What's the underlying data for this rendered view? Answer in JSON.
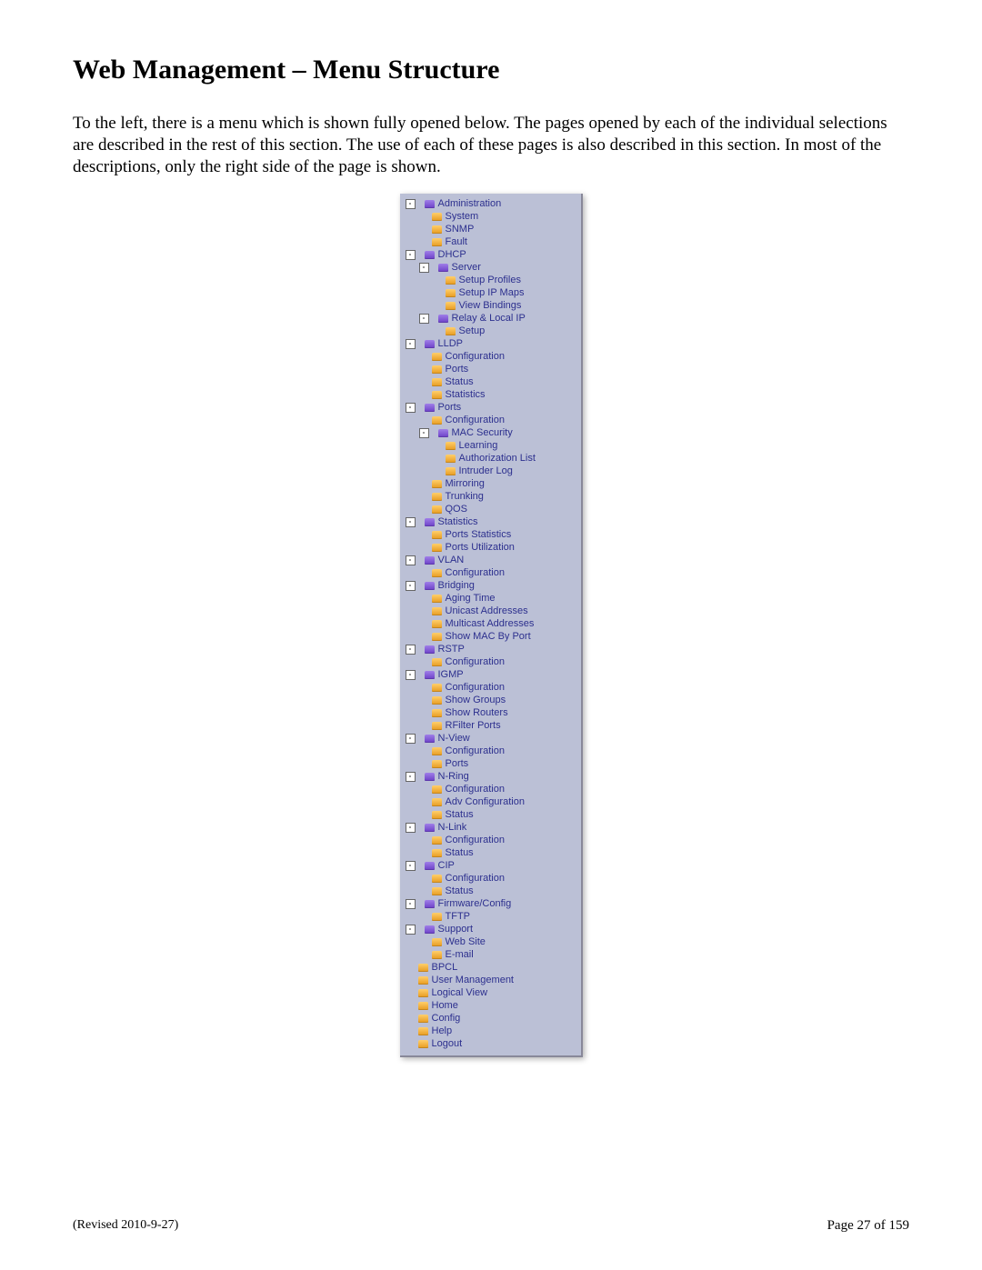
{
  "title": "Web Management – Menu Structure",
  "intro": "To the left, there is a menu which is shown fully opened below.  The pages opened by each of the individual selections are described in the rest of this section.  The use of each of these pages is also described in this section.  In most of the descriptions, only the right side of the page is shown.",
  "footer": {
    "revised": "(Revised 2010-9-27)",
    "page": "Page 27 of 159"
  },
  "menu": [
    {
      "depth": 0,
      "toggle": "-",
      "icon": "purple",
      "label": "Administration"
    },
    {
      "depth": 1,
      "icon": "orange",
      "label": "System"
    },
    {
      "depth": 1,
      "icon": "orange",
      "label": "SNMP"
    },
    {
      "depth": 1,
      "icon": "orange",
      "label": "Fault"
    },
    {
      "depth": 0,
      "toggle": "-",
      "icon": "purple",
      "label": "DHCP"
    },
    {
      "depth": 1,
      "toggle": "-",
      "icon": "purple",
      "label": "Server"
    },
    {
      "depth": 2,
      "icon": "orange",
      "label": "Setup Profiles"
    },
    {
      "depth": 2,
      "icon": "orange",
      "label": "Setup IP Maps"
    },
    {
      "depth": 2,
      "icon": "orange",
      "label": "View Bindings"
    },
    {
      "depth": 1,
      "toggle": "-",
      "icon": "purple",
      "label": "Relay & Local IP"
    },
    {
      "depth": 2,
      "icon": "orange",
      "label": "Setup"
    },
    {
      "depth": 0,
      "toggle": "-",
      "icon": "purple",
      "label": "LLDP"
    },
    {
      "depth": 1,
      "icon": "orange",
      "label": "Configuration"
    },
    {
      "depth": 1,
      "icon": "orange",
      "label": "Ports"
    },
    {
      "depth": 1,
      "icon": "orange",
      "label": "Status"
    },
    {
      "depth": 1,
      "icon": "orange",
      "label": "Statistics"
    },
    {
      "depth": 0,
      "toggle": "-",
      "icon": "purple",
      "label": "Ports"
    },
    {
      "depth": 1,
      "icon": "orange",
      "label": "Configuration"
    },
    {
      "depth": 1,
      "toggle": "-",
      "icon": "purple",
      "label": "MAC Security"
    },
    {
      "depth": 2,
      "icon": "orange",
      "label": "Learning"
    },
    {
      "depth": 2,
      "icon": "orange",
      "label": "Authorization List"
    },
    {
      "depth": 2,
      "icon": "orange",
      "label": "Intruder Log"
    },
    {
      "depth": 1,
      "icon": "orange",
      "label": "Mirroring"
    },
    {
      "depth": 1,
      "icon": "orange",
      "label": "Trunking"
    },
    {
      "depth": 1,
      "icon": "orange",
      "label": "QOS"
    },
    {
      "depth": 0,
      "toggle": "-",
      "icon": "purple",
      "label": "Statistics"
    },
    {
      "depth": 1,
      "icon": "orange",
      "label": "Ports Statistics"
    },
    {
      "depth": 1,
      "icon": "orange",
      "label": "Ports Utilization"
    },
    {
      "depth": 0,
      "toggle": "-",
      "icon": "purple",
      "label": "VLAN"
    },
    {
      "depth": 1,
      "icon": "orange",
      "label": "Configuration"
    },
    {
      "depth": 0,
      "toggle": "-",
      "icon": "purple",
      "label": "Bridging"
    },
    {
      "depth": 1,
      "icon": "orange",
      "label": "Aging Time"
    },
    {
      "depth": 1,
      "icon": "orange",
      "label": "Unicast Addresses"
    },
    {
      "depth": 1,
      "icon": "orange",
      "label": "Multicast Addresses"
    },
    {
      "depth": 1,
      "icon": "orange",
      "label": "Show MAC By Port"
    },
    {
      "depth": 0,
      "toggle": "-",
      "icon": "purple",
      "label": "RSTP"
    },
    {
      "depth": 1,
      "icon": "orange",
      "label": "Configuration"
    },
    {
      "depth": 0,
      "toggle": "-",
      "icon": "purple",
      "label": "IGMP"
    },
    {
      "depth": 1,
      "icon": "orange",
      "label": "Configuration"
    },
    {
      "depth": 1,
      "icon": "orange",
      "label": "Show Groups"
    },
    {
      "depth": 1,
      "icon": "orange",
      "label": "Show Routers"
    },
    {
      "depth": 1,
      "icon": "orange",
      "label": "RFilter Ports"
    },
    {
      "depth": 0,
      "toggle": "-",
      "icon": "purple",
      "label": "N-View"
    },
    {
      "depth": 1,
      "icon": "orange",
      "label": "Configuration"
    },
    {
      "depth": 1,
      "icon": "orange",
      "label": "Ports"
    },
    {
      "depth": 0,
      "toggle": "-",
      "icon": "purple",
      "label": "N-Ring"
    },
    {
      "depth": 1,
      "icon": "orange",
      "label": "Configuration"
    },
    {
      "depth": 1,
      "icon": "orange",
      "label": "Adv Configuration"
    },
    {
      "depth": 1,
      "icon": "orange",
      "label": "Status"
    },
    {
      "depth": 0,
      "toggle": "-",
      "icon": "purple",
      "label": "N-Link"
    },
    {
      "depth": 1,
      "icon": "orange",
      "label": "Configuration"
    },
    {
      "depth": 1,
      "icon": "orange",
      "label": "Status"
    },
    {
      "depth": 0,
      "toggle": "-",
      "icon": "purple",
      "label": "CIP"
    },
    {
      "depth": 1,
      "icon": "orange",
      "label": "Configuration"
    },
    {
      "depth": 1,
      "icon": "orange",
      "label": "Status"
    },
    {
      "depth": 0,
      "toggle": "-",
      "icon": "purple",
      "label": "Firmware/Config"
    },
    {
      "depth": 1,
      "icon": "orange",
      "label": "TFTP"
    },
    {
      "depth": 0,
      "toggle": "-",
      "icon": "purple",
      "label": "Support"
    },
    {
      "depth": 1,
      "icon": "orange",
      "label": "Web Site"
    },
    {
      "depth": 1,
      "icon": "orange",
      "label": "E-mail"
    },
    {
      "depth": 0,
      "icon": "orange",
      "label": "BPCL"
    },
    {
      "depth": 0,
      "icon": "orange",
      "label": "User Management"
    },
    {
      "depth": 0,
      "icon": "orange",
      "label": "Logical View"
    },
    {
      "depth": 0,
      "icon": "orange",
      "label": "Home"
    },
    {
      "depth": 0,
      "icon": "orange",
      "label": "Config"
    },
    {
      "depth": 0,
      "icon": "orange",
      "label": "Help"
    },
    {
      "depth": 0,
      "icon": "orange",
      "label": "Logout"
    }
  ]
}
